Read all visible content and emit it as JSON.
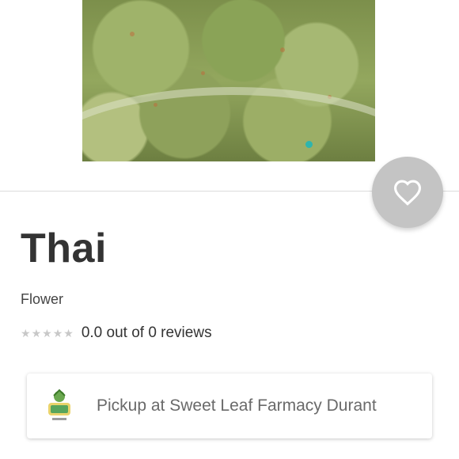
{
  "product": {
    "name": "Thai",
    "category": "Flower",
    "rating_value": 0,
    "rating_max": 5,
    "rating_text": "0.0 out of 0 reviews"
  },
  "carousel": {
    "slide_count": 2,
    "active_index": 0,
    "active_color": "#2fb5ad"
  },
  "favorite": {
    "icon": "heart-outline-icon",
    "bg_color": "#c4c4c4"
  },
  "pickup": {
    "label": "Pickup at Sweet Leaf Farmacy Durant",
    "logo": "sweet-leaf-logo"
  }
}
